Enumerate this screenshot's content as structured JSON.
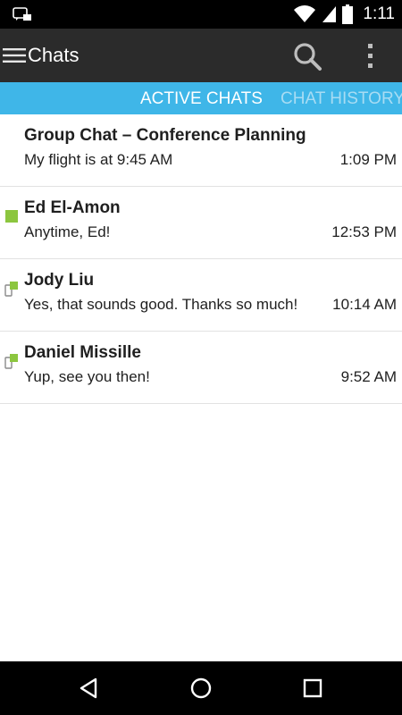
{
  "status_bar": {
    "time": "1:11",
    "icons": [
      "chat-notification-icon",
      "wifi-icon",
      "cell-signal-icon",
      "battery-icon"
    ]
  },
  "action_bar": {
    "title": "Chats",
    "icons": [
      "menu-icon",
      "search-icon",
      "overflow-menu-icon"
    ]
  },
  "tabs": [
    {
      "label": "ACTIVE CHATS",
      "active": true
    },
    {
      "label": "CHAT HISTORY",
      "active": false
    }
  ],
  "chats": [
    {
      "name": "Group Chat – Conference Planning",
      "message": "My flight is at 9:45 AM",
      "time": "1:09 PM",
      "presence": "none"
    },
    {
      "name": "Ed El-Amon",
      "message": "Anytime, Ed!",
      "time": "12:53 PM",
      "presence": "available"
    },
    {
      "name": "Jody Liu",
      "message": "Yes, that sounds good. Thanks so much!",
      "time": "10:14 AM",
      "presence": "mobile-available"
    },
    {
      "name": "Daniel Missille",
      "message": "Yup, see you then!",
      "time": "9:52 AM",
      "presence": "mobile-available"
    }
  ],
  "nav_bar": {
    "icons": [
      "back-icon",
      "home-icon",
      "recent-apps-icon"
    ]
  },
  "colors": {
    "tab_bar": "#3fb6e8",
    "action_bar": "#2b2b2b",
    "presence_available": "#8cc63f"
  }
}
